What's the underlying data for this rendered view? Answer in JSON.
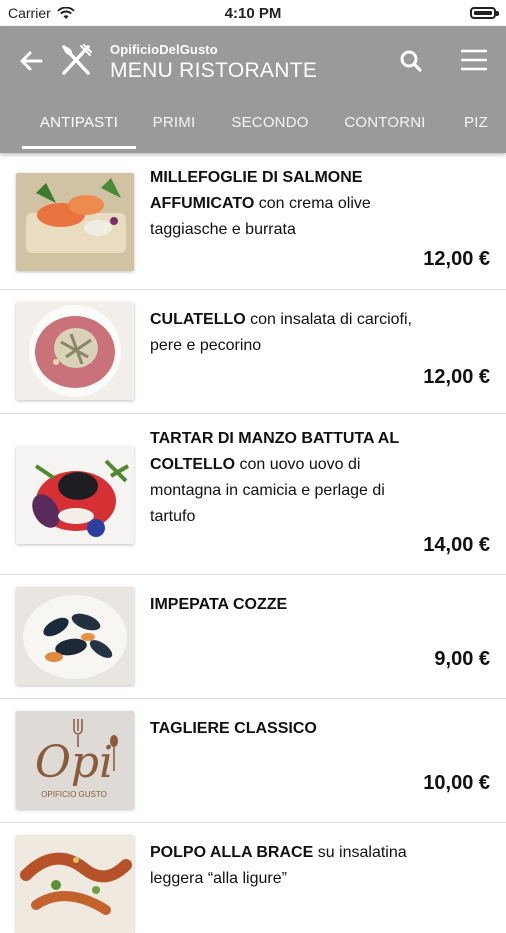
{
  "status_bar": {
    "carrier": "Carrier",
    "time": "4:10 PM"
  },
  "header": {
    "subtitle": "OpificioDelGusto",
    "title": "MENU RISTORANTE"
  },
  "tabs": [
    {
      "label": "ANTIPASTI",
      "active": true
    },
    {
      "label": "PRIMI",
      "active": false
    },
    {
      "label": "SECONDO",
      "active": false
    },
    {
      "label": "CONTORNI",
      "active": false
    },
    {
      "label": "PIZ",
      "active": false
    }
  ],
  "items": [
    {
      "name": "MILLEFOGLIE DI SALMONE AFFUMICATO",
      "detail": " con crema olive taggiasche e burrata",
      "price": "12,00 €"
    },
    {
      "name": "CULATELLO",
      "detail": " con insalata di carciofi, pere e pecorino",
      "price": "12,00 €"
    },
    {
      "name": "TARTAR DI MANZO BATTUTA AL COLTELLO",
      "detail": " con uovo uovo di montagna in camicia e perlage di tartufo",
      "price": "14,00 €"
    },
    {
      "name": "IMPEPATA COZZE",
      "detail": "",
      "price": "9,00 €"
    },
    {
      "name": "TAGLIERE CLASSICO",
      "detail": "",
      "price": "10,00 €",
      "logo_text": "Opi",
      "logo_sub": "OPIFICIO GUSTO"
    },
    {
      "name": "POLPO ALLA BRACE",
      "detail": " su insalatina leggera “alla ligure”",
      "price": ""
    }
  ]
}
